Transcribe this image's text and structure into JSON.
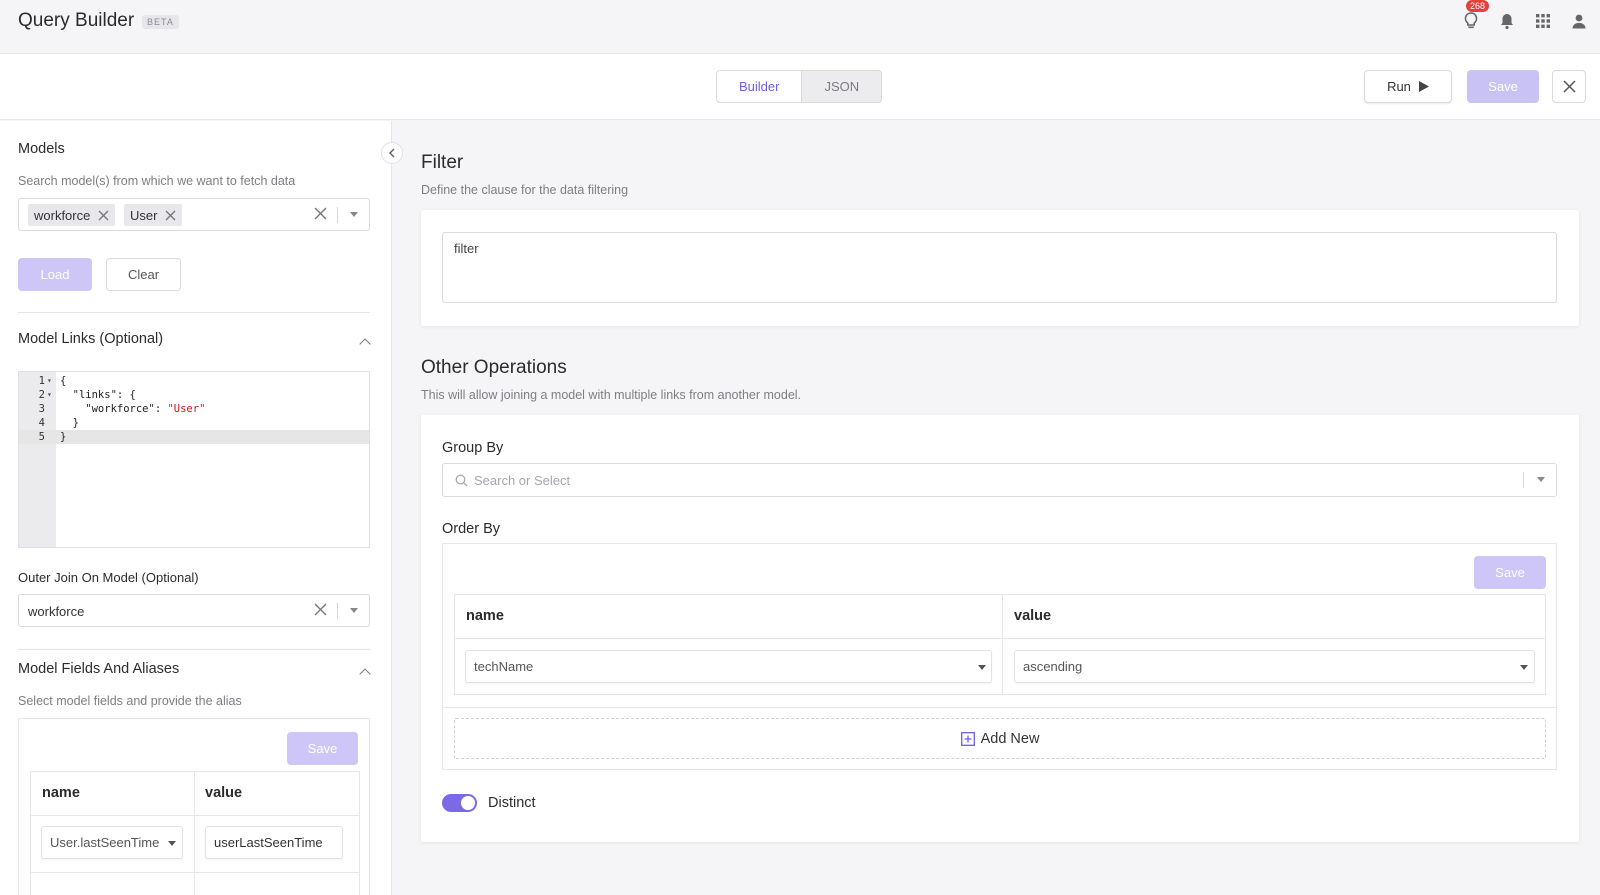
{
  "header": {
    "title": "Query Builder",
    "beta": "BETA",
    "notification_count": "268"
  },
  "toolbar": {
    "tabs": [
      {
        "label": "Builder",
        "active": true
      },
      {
        "label": "JSON",
        "active": false
      }
    ],
    "run_label": "Run",
    "save_label": "Save"
  },
  "models": {
    "title": "Models",
    "subtitle": "Search model(s) from which we want to fetch data",
    "chips": [
      "workforce",
      "User"
    ],
    "load_label": "Load",
    "clear_label": "Clear"
  },
  "model_links": {
    "title": "Model Links (Optional)",
    "lines": [
      {
        "n": "1",
        "fold": true,
        "text": "{"
      },
      {
        "n": "2",
        "fold": true,
        "text": "  \"links\": {"
      },
      {
        "n": "3",
        "fold": false,
        "text": "    \"workforce\": ",
        "str": "\"User\""
      },
      {
        "n": "4",
        "fold": false,
        "text": "  }"
      },
      {
        "n": "5",
        "fold": false,
        "text": "}"
      }
    ]
  },
  "outer_join": {
    "label": "Outer Join On Model (Optional)",
    "value": "workforce"
  },
  "model_fields": {
    "title": "Model Fields And Aliases",
    "subtitle": "Select model fields and provide the alias",
    "save_label": "Save",
    "col_name": "name",
    "col_value": "value",
    "row_name": "User.lastSeenTime",
    "row_value": "userLastSeenTime"
  },
  "filter": {
    "title": "Filter",
    "subtitle": "Define the clause for the data filtering",
    "placeholder": "filter"
  },
  "other_ops": {
    "title": "Other Operations",
    "subtitle": "This will allow joining a model with multiple links from another model.",
    "group_by_label": "Group By",
    "group_by_placeholder": "Search or Select",
    "order_by_label": "Order By",
    "save_label": "Save",
    "col_name": "name",
    "col_value": "value",
    "row_name": "techName",
    "row_value": "ascending",
    "add_new_label": "Add New",
    "distinct_label": "Distinct",
    "distinct_on": true
  },
  "colors": {
    "accent": "#6f5ee0",
    "accent_disabled": "#cdc6f7",
    "badge": "#e5413b"
  }
}
